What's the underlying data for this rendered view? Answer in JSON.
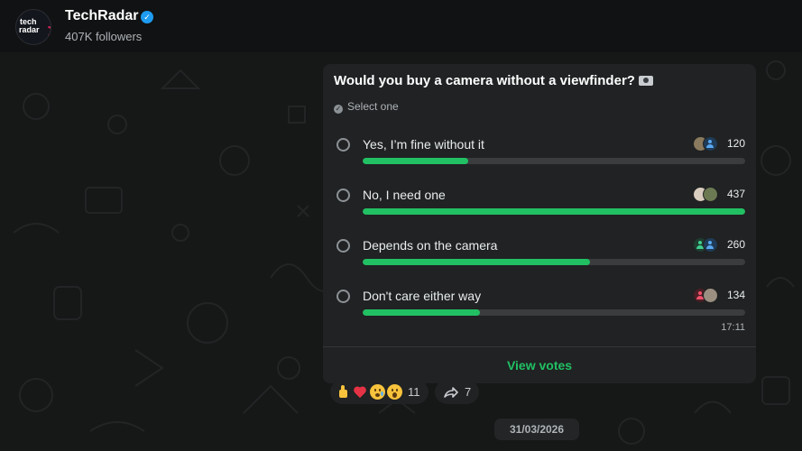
{
  "channel": {
    "logo_line1": "tech",
    "logo_line2": "radar",
    "name": "TechRadar",
    "followers": "407K followers"
  },
  "poll": {
    "question": "Would you buy a camera without a viewfinder?",
    "question_emoji": "camera-icon",
    "instruction": "Select one",
    "options": [
      {
        "label": "Yes, I’m fine without it",
        "count": "120",
        "votes": 120,
        "fill_fraction": 0.275
      },
      {
        "label": "No, I need one",
        "count": "437",
        "votes": 437,
        "fill_fraction": 1.0
      },
      {
        "label": "Depends on the camera",
        "count": "260",
        "votes": 260,
        "fill_fraction": 0.595
      },
      {
        "label": "Don't care either way",
        "count": "134",
        "votes": 134,
        "fill_fraction": 0.307
      }
    ],
    "time": "17:11",
    "view_votes_label": "View votes"
  },
  "reactions": {
    "emojis": [
      "thumbs-up-icon",
      "red-heart-icon",
      "crying-face-icon",
      "surprised-face-icon"
    ],
    "count": "11",
    "forwards_count": "7"
  },
  "date_label": "31/03/2026",
  "colors": {
    "accent_green": "#21c063",
    "card_bg": "#202223",
    "verified_blue": "#1d9bf0"
  }
}
